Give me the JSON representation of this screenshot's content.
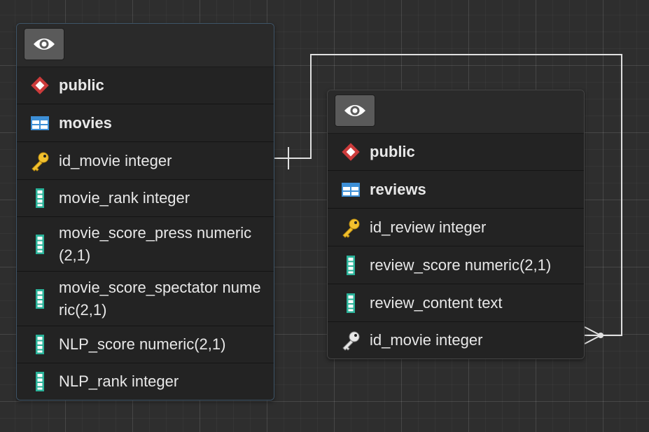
{
  "colors": {
    "background": "#2e2e2e",
    "card": "#232323",
    "connector": "#e0e0e0",
    "schema_icon": "#cc3b3b",
    "table_icon": "#3d8fd6",
    "key_icon": "#f2c12e",
    "column_icon": "#2bb39a"
  },
  "tables": [
    {
      "toggle_icon": "eye-icon",
      "schema": "public",
      "schema_icon": "diamond-icon",
      "name": "movies",
      "table_icon": "table-icon",
      "columns": [
        {
          "text": "id_movie integer",
          "icon": "primary-key-icon"
        },
        {
          "text": "movie_rank integer",
          "icon": "column-icon"
        },
        {
          "text": "movie_score_press numeric(2,1)",
          "icon": "column-icon"
        },
        {
          "text": "movie_score_spectator numeric(2,1)",
          "icon": "column-icon"
        },
        {
          "text": "NLP_score numeric(2,1)",
          "icon": "column-icon"
        },
        {
          "text": "NLP_rank integer",
          "icon": "column-icon"
        }
      ]
    },
    {
      "toggle_icon": "eye-icon",
      "schema": "public",
      "schema_icon": "diamond-icon",
      "name": "reviews",
      "table_icon": "table-icon",
      "columns": [
        {
          "text": "id_review integer",
          "icon": "primary-key-icon"
        },
        {
          "text": "review_score numeric(2,1)",
          "icon": "column-icon"
        },
        {
          "text": "review_content text",
          "icon": "column-icon"
        },
        {
          "text": "id_movie integer",
          "icon": "foreign-key-icon"
        }
      ]
    }
  ],
  "relationship": {
    "from": "movies.id_movie",
    "to": "reviews.id_movie",
    "from_cardinality": "one",
    "to_cardinality": "many"
  }
}
